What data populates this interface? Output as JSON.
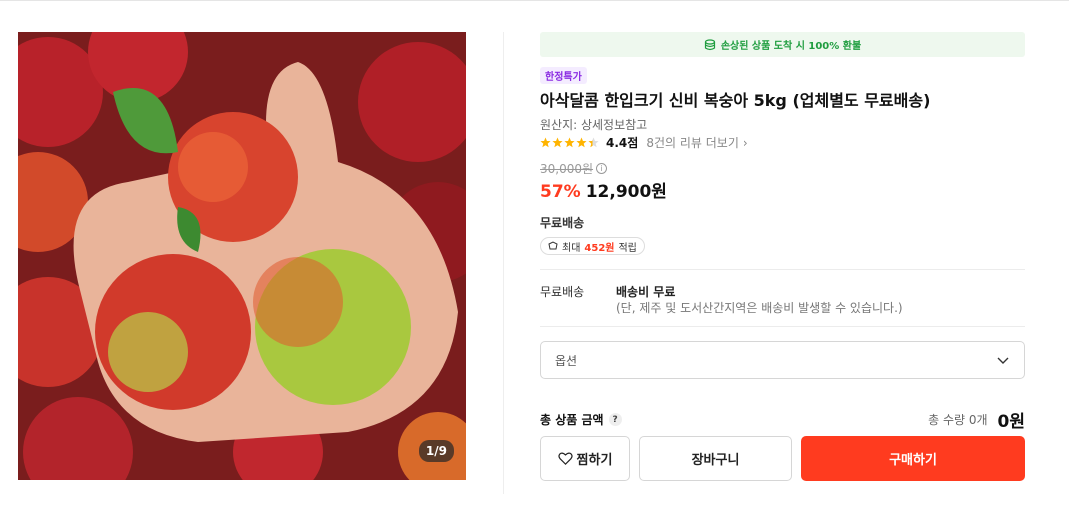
{
  "gallery": {
    "counter": "1/9"
  },
  "product": {
    "refund_notice": "손상된 상품 도착 시 100% 환불",
    "badge": "한정특가",
    "title": "아삭달콤 한입크기 신비 복숭아 5kg (업체별도 무료배송)",
    "origin": "원산지: 상세정보참고",
    "rating": {
      "stars": 4.4,
      "score": "4.4점",
      "reviews": "8건의 리뷰 더보기"
    },
    "original_price": "30,000원",
    "discount": "57%",
    "price": "12,900원"
  },
  "shipping": {
    "label": "무료배송",
    "points_prefix": "최대",
    "points_amount": "452원",
    "points_suffix": "적립",
    "key": "무료배송",
    "fee": "배송비 무료",
    "note": "(단, 제주 및 도서산간지역은 배송비 발생할 수 있습니다.)"
  },
  "option": {
    "placeholder": "옵션"
  },
  "total": {
    "label": "총 상품 금액",
    "help": "?",
    "qty": "총 수량 0개",
    "amount": "0원"
  },
  "buttons": {
    "wish": "찜하기",
    "cart": "장바구니",
    "buy": "구매하기"
  },
  "colors": {
    "accent": "#ff3b1f",
    "refund_green": "#1f9d3f",
    "badge_purple": "#8a2be2",
    "star": "#ffb400"
  }
}
